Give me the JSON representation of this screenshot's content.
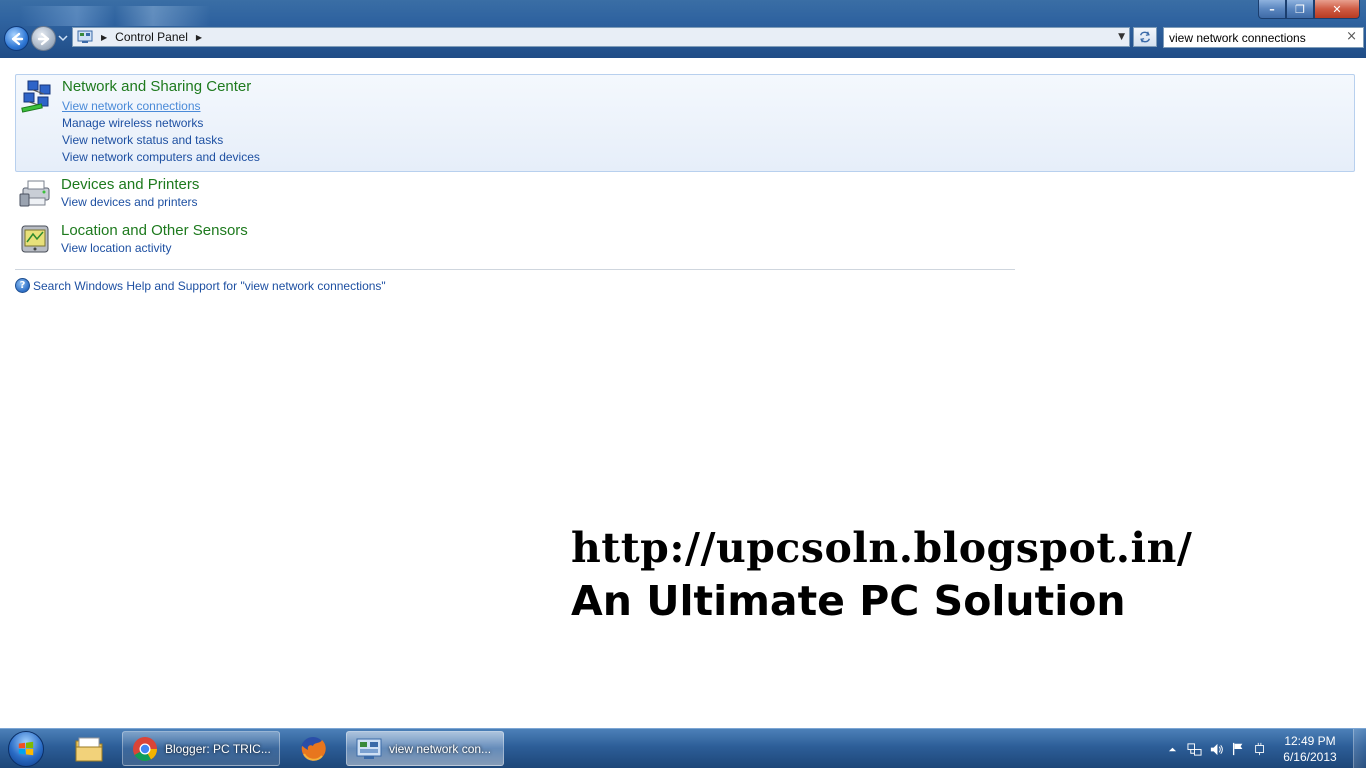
{
  "window": {
    "minimize_label": "–",
    "maximize_label": "❐",
    "close_label": "✕"
  },
  "address_bar": {
    "breadcrumb": "Control Panel",
    "dropdown_icon": "chevron-down-icon"
  },
  "search": {
    "value": "view network connections",
    "clear_label": "×"
  },
  "results": [
    {
      "title": "Network and Sharing Center",
      "icon": "network-icon",
      "links": [
        "View network connections",
        "Manage wireless networks",
        "View network status and tasks",
        "View network computers and devices"
      ]
    },
    {
      "title": "Devices and Printers",
      "icon": "printer-icon",
      "links": [
        "View devices and printers"
      ]
    },
    {
      "title": "Location and Other Sensors",
      "icon": "sensor-icon",
      "links": [
        "View location activity"
      ]
    }
  ],
  "help": {
    "text": "Search Windows Help and Support for \"view network connections\""
  },
  "watermark": {
    "line1": "http://upcsoln.blogspot.in/",
    "line2": "An Ultimate PC Solution"
  },
  "taskbar": {
    "items": [
      {
        "label": "Blogger: PC TRIC...",
        "icon": "chrome-icon"
      },
      {
        "label": "view network con...",
        "icon": "control-panel-icon"
      }
    ],
    "clock": {
      "time": "12:49 PM",
      "date": "6/16/2013"
    }
  },
  "colors": {
    "title_green": "#1e7a1e",
    "link_blue": "#1e50a2",
    "visited_link": "#4a8ad8",
    "taskbar": "#2d5e98"
  }
}
